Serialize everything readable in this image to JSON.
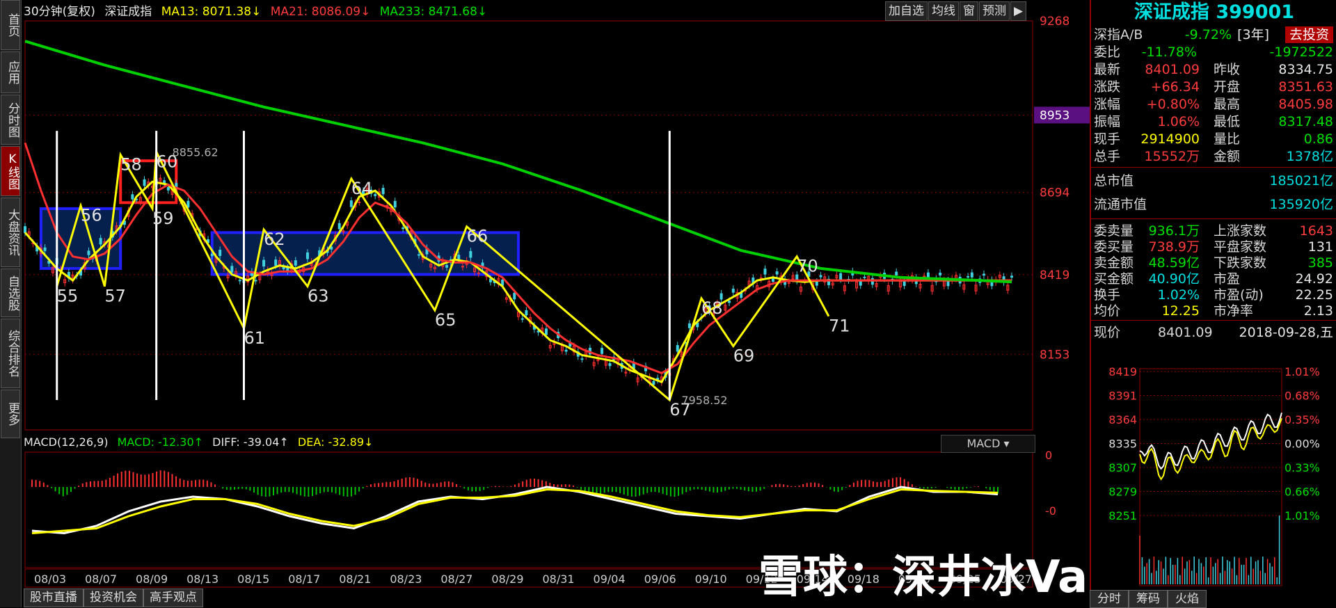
{
  "left_tabs": [
    "首页",
    "应用",
    "分时图",
    "K线图",
    "大盘资讯",
    "自选股",
    "综合排名",
    "更多"
  ],
  "active_left_tab": 3,
  "header": {
    "period": "30分钟(复权)",
    "index_name": "深证成指",
    "ma13": "MA13: 8071.38↓",
    "ma21": "MA21: 8086.09↓",
    "ma233": "MA233: 8471.68↓"
  },
  "toolbar": [
    "加自选",
    "均线",
    "窗",
    "预测"
  ],
  "macd_header": {
    "label": "MACD(12,26,9)",
    "macd": "MACD: -12.30↑",
    "diff": "DIFF: -39.04↑",
    "dea": "DEA: -32.89↓",
    "selector": "MACD"
  },
  "bottom_tabs": [
    "股市直播",
    "投资机会",
    "高手观点"
  ],
  "watermark": "雪球：深井冰Vampire",
  "colors": {
    "ma13": "#ffff00",
    "ma21": "#ff3030",
    "ma233": "#00d000",
    "up": "#ff3030",
    "down": "#40d0e0"
  },
  "chart_data": {
    "type": "line",
    "price_axis": {
      "ticks": [
        9268,
        8953,
        8694,
        8419,
        8153
      ],
      "highlight": "8953",
      "range": [
        7900,
        9268
      ]
    },
    "macd_axis": {
      "ticks": [
        "0",
        "-0"
      ]
    },
    "x_ticks": [
      "08/03",
      "08/07",
      "08/09",
      "08/13",
      "08/15",
      "08/17",
      "08/21",
      "08/23",
      "08/27",
      "08/29",
      "08/31",
      "09/04",
      "09/06",
      "09/10",
      "09/12",
      "09/14",
      "09/18",
      "09/20",
      "09/25",
      "09/27"
    ],
    "series": [
      {
        "name": "MA13",
        "x": [
          0,
          4,
          8,
          12,
          16,
          20,
          24,
          28,
          32,
          36,
          40,
          44,
          48,
          52,
          56,
          60,
          64,
          68,
          72,
          76,
          80,
          84,
          88,
          92,
          96,
          100,
          104,
          108,
          112,
          116,
          120,
          124,
          128,
          132,
          136,
          140,
          144,
          148,
          152,
          156,
          160,
          164,
          168,
          172,
          176,
          180,
          184,
          188,
          192,
          196,
          200,
          204,
          208,
          212,
          216,
          220,
          224,
          228,
          232,
          236,
          240,
          244,
          248
        ],
        "y": [
          8560,
          8500,
          8440,
          8400,
          8470,
          8520,
          8580,
          8680,
          8730,
          8720,
          8660,
          8560,
          8480,
          8420,
          8400,
          8430,
          8450,
          8440,
          8460,
          8500,
          8580,
          8680,
          8700,
          8650,
          8570,
          8480,
          8450,
          8470,
          8460,
          8420,
          8380,
          8300,
          8250,
          8200,
          8180,
          8150,
          8140,
          8130,
          8100,
          8080,
          8060,
          8150,
          8250,
          8300,
          8330,
          8360,
          8400,
          8410,
          8400,
          8395,
          8400,
          8400,
          8400,
          8400,
          8400,
          8400,
          8400,
          8400,
          8400,
          8400,
          8400,
          8400,
          8400
        ]
      },
      {
        "name": "MA21",
        "x": [
          0,
          4,
          8,
          12,
          16,
          20,
          24,
          28,
          32,
          36,
          40,
          44,
          48,
          52,
          56,
          60,
          64,
          68,
          72,
          76,
          80,
          84,
          88,
          92,
          96,
          100,
          104,
          108,
          112,
          116,
          120,
          124,
          128,
          132,
          136,
          140,
          144,
          148,
          152,
          156,
          160,
          164,
          168,
          172,
          176,
          180,
          184,
          188,
          192,
          196,
          200,
          204,
          208,
          212,
          216,
          220,
          224,
          228,
          232,
          236,
          240,
          244,
          248
        ],
        "y": [
          8860,
          8700,
          8560,
          8480,
          8470,
          8490,
          8540,
          8620,
          8690,
          8720,
          8700,
          8640,
          8560,
          8480,
          8430,
          8420,
          8430,
          8430,
          8440,
          8470,
          8530,
          8610,
          8660,
          8640,
          8590,
          8520,
          8470,
          8460,
          8460,
          8440,
          8410,
          8350,
          8290,
          8240,
          8200,
          8170,
          8150,
          8140,
          8130,
          8110,
          8090,
          8120,
          8190,
          8250,
          8290,
          8330,
          8370,
          8390,
          8400,
          8400,
          8400,
          8400,
          8400,
          8400,
          8400,
          8400,
          8400,
          8400,
          8400,
          8400,
          8400,
          8400,
          8400
        ]
      },
      {
        "name": "MA233",
        "x": [
          0,
          20,
          40,
          60,
          80,
          100,
          120,
          140,
          160,
          180,
          200,
          220,
          240,
          248
        ],
        "y": [
          9200,
          9120,
          9050,
          8980,
          8920,
          8860,
          8790,
          8700,
          8600,
          8500,
          8440,
          8410,
          8400,
          8395
        ]
      }
    ],
    "annotations": [
      {
        "text": "55",
        "x": 8,
        "y": 8380
      },
      {
        "text": "56",
        "x": 14,
        "y": 8650
      },
      {
        "text": "57",
        "x": 20,
        "y": 8380
      },
      {
        "text": "58",
        "x": 24,
        "y": 8820
      },
      {
        "text": "60",
        "x": 33,
        "y": 8830
      },
      {
        "text": "8855.62",
        "x": 37,
        "y": 8830
      },
      {
        "text": "59",
        "x": 32,
        "y": 8640
      },
      {
        "text": "61",
        "x": 55,
        "y": 8240
      },
      {
        "text": "62",
        "x": 60,
        "y": 8570
      },
      {
        "text": "63",
        "x": 71,
        "y": 8380
      },
      {
        "text": "64",
        "x": 82,
        "y": 8740
      },
      {
        "text": "65",
        "x": 103,
        "y": 8300
      },
      {
        "text": "66",
        "x": 111,
        "y": 8580
      },
      {
        "text": "67",
        "x": 162,
        "y": 8000
      },
      {
        "text": "7958.52",
        "x": 165,
        "y": 8000
      },
      {
        "text": "68",
        "x": 170,
        "y": 8340
      },
      {
        "text": "69",
        "x": 178,
        "y": 8180
      },
      {
        "text": "70",
        "x": 194,
        "y": 8480
      },
      {
        "text": "71",
        "x": 202,
        "y": 8280
      }
    ],
    "boxes": [
      {
        "color": "blue",
        "x0": 4,
        "x1": 24,
        "y0": 8640,
        "y1": 8440
      },
      {
        "color": "red",
        "x0": 24,
        "x1": 38,
        "y0": 8800,
        "y1": 8660
      },
      {
        "color": "blue",
        "x0": 47,
        "x1": 124,
        "y0": 8560,
        "y1": 8420
      }
    ],
    "macd": {
      "diff": [
        -0.9,
        -0.95,
        -0.8,
        -0.5,
        -0.3,
        -0.2,
        -0.25,
        -0.4,
        -0.6,
        -0.75,
        -0.85,
        -0.6,
        -0.3,
        -0.2,
        -0.25,
        -0.15,
        0.0,
        -0.1,
        -0.25,
        -0.4,
        -0.55,
        -0.6,
        -0.65,
        -0.55,
        -0.45,
        -0.5,
        -0.2,
        0.0,
        -0.1,
        -0.1,
        -0.15
      ],
      "dea": [
        -0.95,
        -0.9,
        -0.85,
        -0.6,
        -0.4,
        -0.25,
        -0.25,
        -0.35,
        -0.55,
        -0.7,
        -0.8,
        -0.65,
        -0.35,
        -0.22,
        -0.22,
        -0.18,
        -0.05,
        -0.08,
        -0.2,
        -0.35,
        -0.5,
        -0.58,
        -0.62,
        -0.55,
        -0.48,
        -0.48,
        -0.25,
        -0.05,
        -0.08,
        -0.1,
        -0.12
      ]
    }
  },
  "quote": {
    "title": "深证成指 399001",
    "rows1": [
      {
        "label": "深指A/B",
        "value": "-9.72%",
        "extra": "[3年]",
        "button": "去投资"
      },
      {
        "label": "委比",
        "value": "-11.78%",
        "value2": "-1972522"
      },
      {
        "label": "最新",
        "value": "8401.09",
        "label2": "昨收",
        "value2": "8334.75"
      },
      {
        "label": "涨跌",
        "value": "+66.34",
        "label2": "开盘",
        "value2": "8351.63"
      },
      {
        "label": "涨幅",
        "value": "+0.80%",
        "label2": "最高",
        "value2": "8405.98"
      },
      {
        "label": "振幅",
        "value": "1.06%",
        "label2": "最低",
        "value2": "8317.48"
      },
      {
        "label": "现手",
        "value": "2914900",
        "label2": "量比",
        "value2": "0.86"
      },
      {
        "label": "总手",
        "value": "15552万",
        "label2": "金额",
        "value2": "1378亿"
      }
    ],
    "mktcap": [
      {
        "label": "总市值",
        "value": "185021亿"
      },
      {
        "label": "流通市值",
        "value": "135920亿"
      }
    ],
    "rows2": [
      {
        "label": "委卖量",
        "value": "936.1万",
        "label2": "上涨家数",
        "value2": "1643"
      },
      {
        "label": "委买量",
        "value": "738.9万",
        "label2": "平盘家数",
        "value2": "131"
      },
      {
        "label": "卖金额",
        "value": "48.59亿",
        "label2": "下跌家数",
        "value2": "385"
      },
      {
        "label": "买金额",
        "value": "40.90亿",
        "label2": "市盈",
        "value2": "24.92"
      },
      {
        "label": "换手",
        "value": "1.02%",
        "label2": "市盈(动)",
        "value2": "22.25"
      },
      {
        "label": "均价",
        "value": "12.25",
        "label2": "市净率",
        "value2": "2.13"
      }
    ],
    "mini": {
      "label": "现价",
      "price": "8401.09",
      "date": "2018-09-28,五",
      "ticks": [
        "8419",
        "8391",
        "8364",
        "8335",
        "8307",
        "8279",
        "8251"
      ],
      "pcts": [
        "1.01%",
        "0.68%",
        "0.35%",
        "0.00%",
        "0.33%",
        "0.66%",
        "1.01%"
      ]
    },
    "bottom_tabs": [
      "分时",
      "筹码",
      "火焰"
    ]
  }
}
